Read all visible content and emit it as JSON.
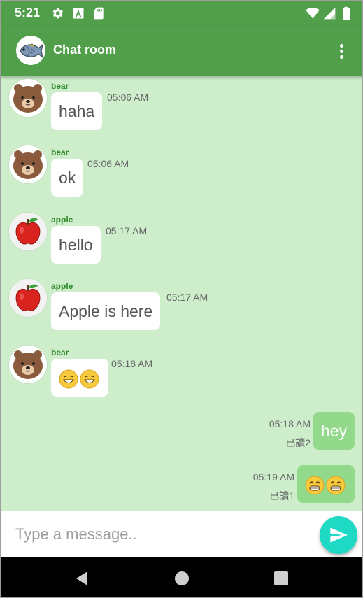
{
  "status_bar": {
    "time": "5:21",
    "icons": [
      "gear-icon",
      "a-box-icon",
      "sd-card-icon",
      "wifi-icon",
      "signal-icon",
      "battery-icon"
    ]
  },
  "app_bar": {
    "title": "Chat room",
    "avatar": "fish-avatar",
    "menu_icon": "more-vert-icon"
  },
  "messages": [
    {
      "direction": "in",
      "sender": "bear",
      "avatar": "bear-avatar",
      "text": "haha",
      "time": "05:06 AM"
    },
    {
      "direction": "in",
      "sender": "bear",
      "avatar": "bear-avatar",
      "text": "ok",
      "time": "05:06 AM"
    },
    {
      "direction": "in",
      "sender": "apple",
      "avatar": "apple-avatar",
      "text": "hello",
      "time": "05:17 AM"
    },
    {
      "direction": "in",
      "sender": "apple",
      "avatar": "apple-avatar",
      "text": "Apple is here",
      "time": "05:17 AM"
    },
    {
      "direction": "in",
      "sender": "bear",
      "avatar": "bear-avatar",
      "text": "😀😀",
      "time": "05:18 AM"
    },
    {
      "direction": "out",
      "text": "hey",
      "time": "05:18 AM",
      "read": "已讀2"
    },
    {
      "direction": "out",
      "text": "😁😁",
      "time": "05:19 AM",
      "read": "已讀1"
    }
  ],
  "input": {
    "placeholder": "Type a message..",
    "value": "",
    "send_icon": "send-icon"
  },
  "nav_bar": {
    "icons": [
      "back-icon",
      "home-icon",
      "recents-icon"
    ]
  },
  "colors": {
    "primary": "#519f4b",
    "chat_background": "#cdedcb",
    "outgoing_bubble": "#92d98c",
    "incoming_bubble": "#ffffff",
    "sender_name": "#2e8a2a",
    "send_button": "#1ed9c4"
  }
}
